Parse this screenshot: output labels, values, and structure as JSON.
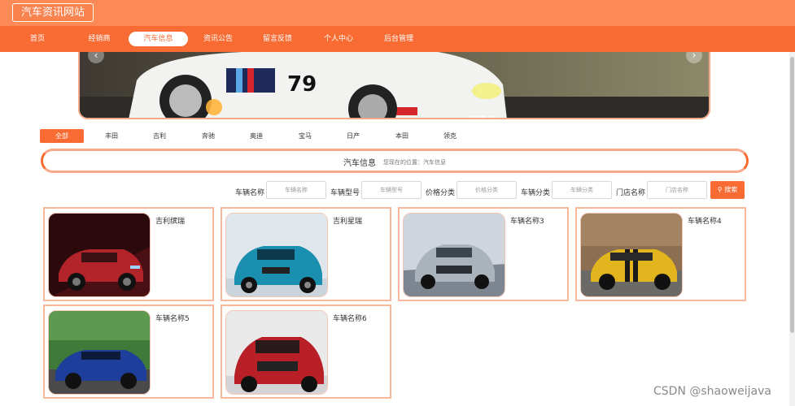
{
  "site": {
    "title": "汽车资讯网站"
  },
  "nav": {
    "items": [
      {
        "label": "首页"
      },
      {
        "label": "经销商"
      },
      {
        "label": "汽车信息"
      },
      {
        "label": "资讯公告"
      },
      {
        "label": "留言反馈"
      },
      {
        "label": "个人中心"
      },
      {
        "label": "后台管理"
      }
    ],
    "active_index": 2
  },
  "banner": {
    "prev_icon": "chevron-left-icon",
    "next_icon": "chevron-right-icon",
    "slides": 3,
    "active_slide": 1
  },
  "categories": {
    "items": [
      {
        "label": "全部"
      },
      {
        "label": "丰田"
      },
      {
        "label": "吉利"
      },
      {
        "label": "奔驰"
      },
      {
        "label": "奥迪"
      },
      {
        "label": "宝马"
      },
      {
        "label": "日产"
      },
      {
        "label": "本田"
      },
      {
        "label": "领克"
      }
    ],
    "active_index": 0
  },
  "info_bar": {
    "title": "汽车信息",
    "breadcrumb": "您现在的位置：汽车信息"
  },
  "search": {
    "fields": [
      {
        "label": "车辆名称",
        "placeholder": "车辆名称"
      },
      {
        "label": "车辆型号",
        "placeholder": "车辆型号"
      },
      {
        "label": "价格分类",
        "placeholder": "价格分类"
      },
      {
        "label": "车辆分类",
        "placeholder": "车辆分类"
      },
      {
        "label": "门店名称",
        "placeholder": "门店名称"
      }
    ],
    "button_label": "搜索",
    "button_icon": "search-icon"
  },
  "cars": [
    {
      "name": "吉利缤瑞",
      "color": "#b3242a"
    },
    {
      "name": "吉利星瑞",
      "color": "#1b8fb0"
    },
    {
      "name": "车辆名称3",
      "color": "#9aa2ad"
    },
    {
      "name": "车辆名称4",
      "color": "#e2b41d"
    },
    {
      "name": "车辆名称5",
      "color": "#1d3f9b"
    },
    {
      "name": "车辆名称6",
      "color": "#b81f26"
    }
  ],
  "watermark": "CSDN @shaoweijava",
  "colors": {
    "primary": "#f86b33",
    "topbar": "#fb8a57",
    "card_border": "#f9b79c"
  }
}
